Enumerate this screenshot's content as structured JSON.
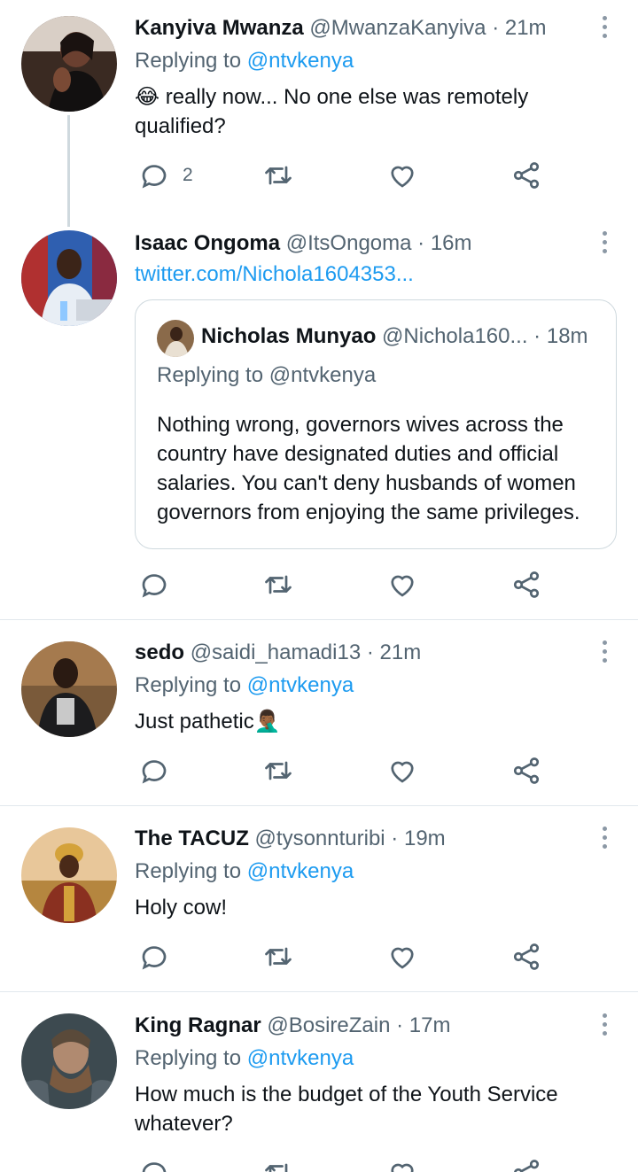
{
  "tweets": [
    {
      "name": "Kanyiva Mwanza",
      "handle": "@MwanzaKanyiva",
      "time": "21m",
      "replying_prefix": "Replying to ",
      "replying_to": "@ntvkenya",
      "emoji": "😂",
      "text": " really now... No one else was remotely qualified?",
      "reply_count": "2"
    },
    {
      "name": "Isaac Ongoma",
      "handle": "@ItsOngoma",
      "time": "16m",
      "link": "twitter.com/Nichola1604353...",
      "quote": {
        "name": "Nicholas Munyao",
        "handle": "@Nichola160...",
        "time": "18m",
        "replying": "Replying to @ntvkenya",
        "text": "Nothing wrong, governors wives across the country have designated duties and official salaries. You can't deny husbands of women governors from enjoying the same privileges."
      }
    },
    {
      "name": "sedo",
      "handle": "@saidi_hamadi13",
      "time": "21m",
      "replying_prefix": "Replying to ",
      "replying_to": "@ntvkenya",
      "text": "Just pathetic",
      "emoji": "🤦🏾‍♂️"
    },
    {
      "name": "The TACUZ",
      "handle": "@tysonnturibi",
      "time": "19m",
      "replying_prefix": "Replying to ",
      "replying_to": "@ntvkenya",
      "text": "Holy cow!"
    },
    {
      "name": "King Ragnar",
      "handle": "@BosireZain",
      "time": "17m",
      "replying_prefix": "Replying to ",
      "replying_to": "@ntvkenya",
      "text": "How much is the budget of the Youth Service whatever?"
    }
  ],
  "separator_dot": " · ",
  "icons": {
    "reply": "reply-icon",
    "retweet": "retweet-icon",
    "like": "heart-icon",
    "share": "share-icon",
    "more": "more-icon"
  },
  "colors": {
    "link": "#1d9bf0",
    "secondary_text": "#536471",
    "border": "#cfd9de"
  }
}
